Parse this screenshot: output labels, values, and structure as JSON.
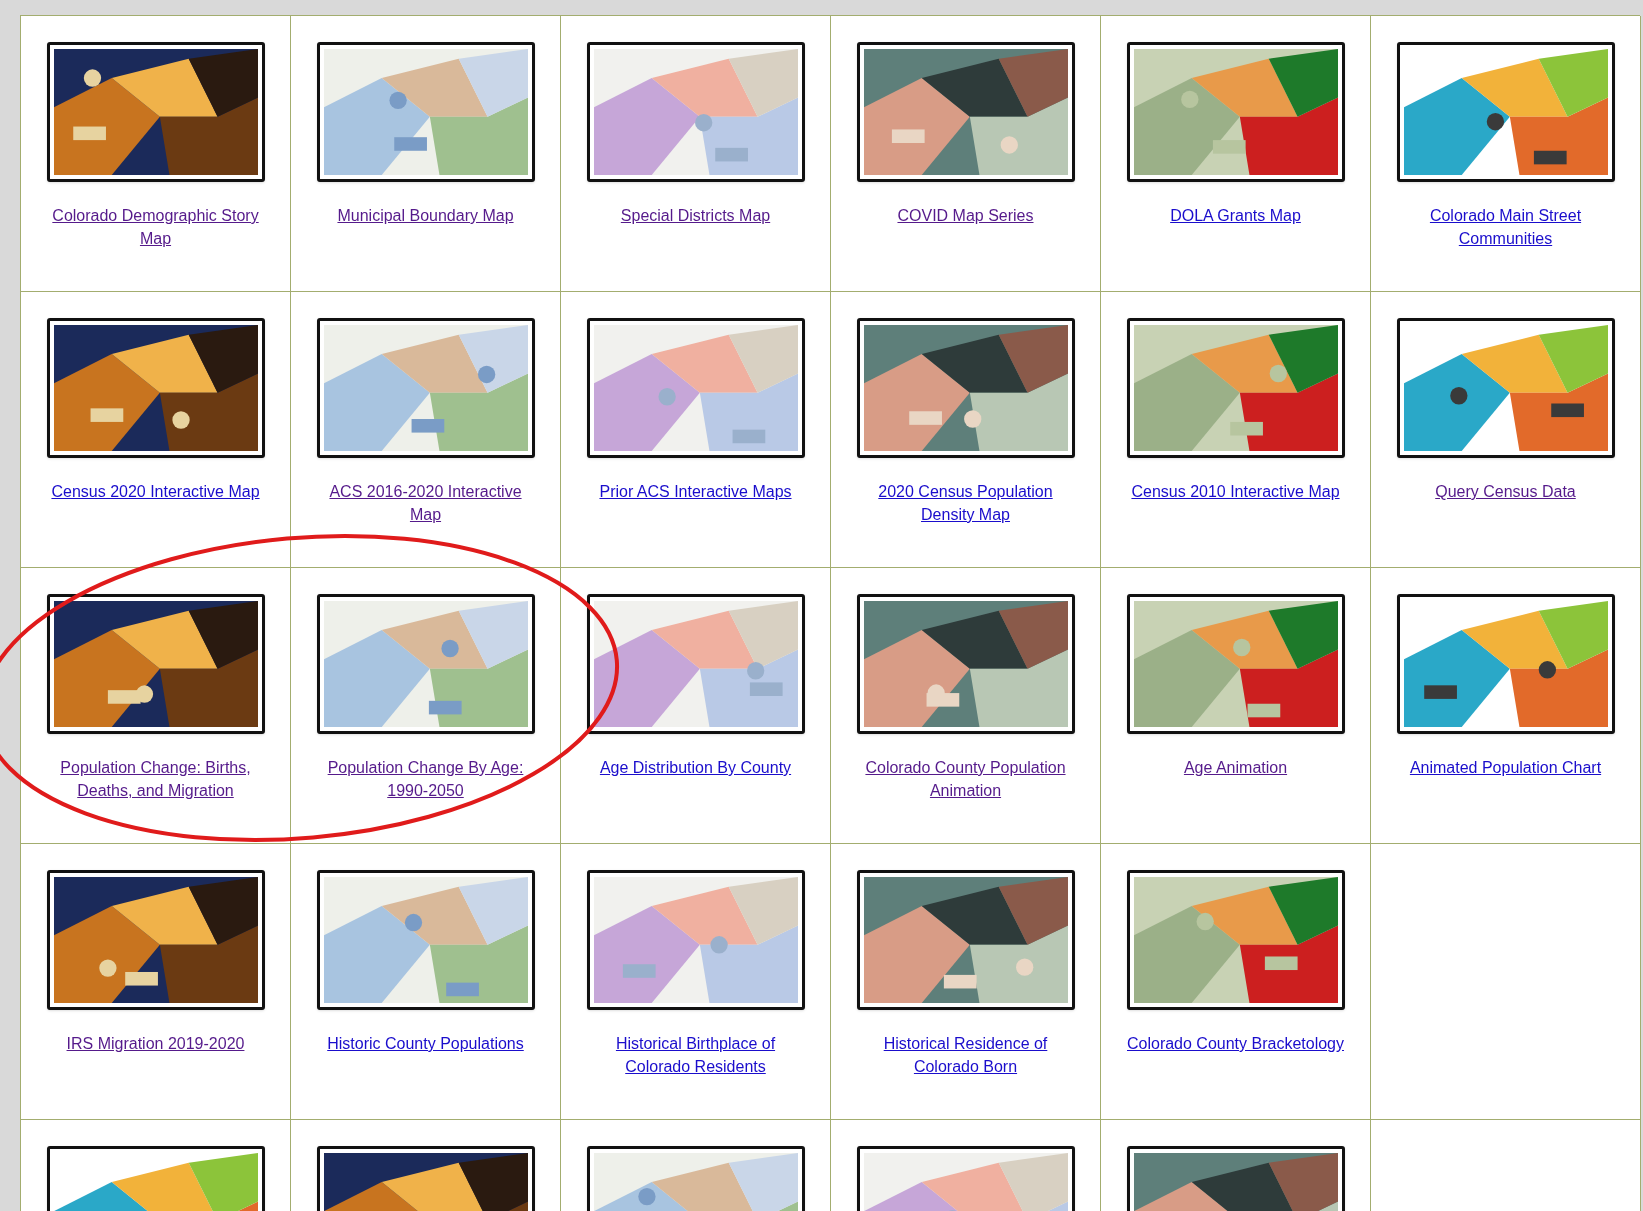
{
  "rows": [
    {
      "items": [
        {
          "kind": "link",
          "label": "Colorado Demographic Story Map",
          "visited": true
        },
        {
          "kind": "link",
          "label": "Municipal Boundary Map",
          "visited": true
        },
        {
          "kind": "link",
          "label": "Special Districts Map",
          "visited": true
        },
        {
          "kind": "link",
          "label": "COVID Map Series",
          "visited": true
        },
        {
          "kind": "link",
          "label": "DOLA Grants Map",
          "visited": false
        },
        {
          "kind": "link",
          "label": "Colorado Main Street Communities",
          "visited": false
        }
      ]
    },
    {
      "items": [
        {
          "kind": "link",
          "label": "Census 2020 Interactive Map",
          "visited": false
        },
        {
          "kind": "link",
          "label": "ACS 2016-2020 Interactive Map",
          "visited": true
        },
        {
          "kind": "link",
          "label": "Prior ACS Interactive Maps",
          "visited": false
        },
        {
          "kind": "link",
          "label": "2020 Census Population Density Map",
          "visited": false
        },
        {
          "kind": "link",
          "label": "Census 2010 Interactive Map",
          "visited": false
        },
        {
          "kind": "link",
          "label": "Query Census Data",
          "visited": true
        }
      ]
    },
    {
      "items": [
        {
          "kind": "link",
          "label": "Population Change: Births, Deaths, and Migration",
          "visited": true
        },
        {
          "kind": "link",
          "label": "Population Change By Age: 1990-2050",
          "visited": true
        },
        {
          "kind": "link",
          "label": "Age Distribution By County",
          "visited": false
        },
        {
          "kind": "link",
          "label": "Colorado County Population Animation",
          "visited": true
        },
        {
          "kind": "link",
          "label": "Age Animation",
          "visited": true
        },
        {
          "kind": "link",
          "label": "Animated Population Chart",
          "visited": false
        }
      ]
    },
    {
      "items": [
        {
          "kind": "link",
          "label": "IRS Migration 2019-2020",
          "visited": true
        },
        {
          "kind": "link",
          "label": "Historic County Populations",
          "visited": false
        },
        {
          "kind": "link",
          "label": "Historical Birthplace of Colorado Residents",
          "visited": false
        },
        {
          "kind": "link",
          "label": "Historical Residence of Colorado Born",
          "visited": false
        },
        {
          "kind": "link",
          "label": "Colorado County Bracketology",
          "visited": false
        }
      ]
    },
    {
      "items": [
        {
          "kind": "picture"
        },
        {
          "kind": "picture"
        },
        {
          "kind": "picture"
        },
        {
          "kind": "picture"
        },
        {
          "kind": "picture"
        }
      ]
    }
  ],
  "annotation": {
    "kind": "ellipse",
    "color": "#e01b1b"
  }
}
